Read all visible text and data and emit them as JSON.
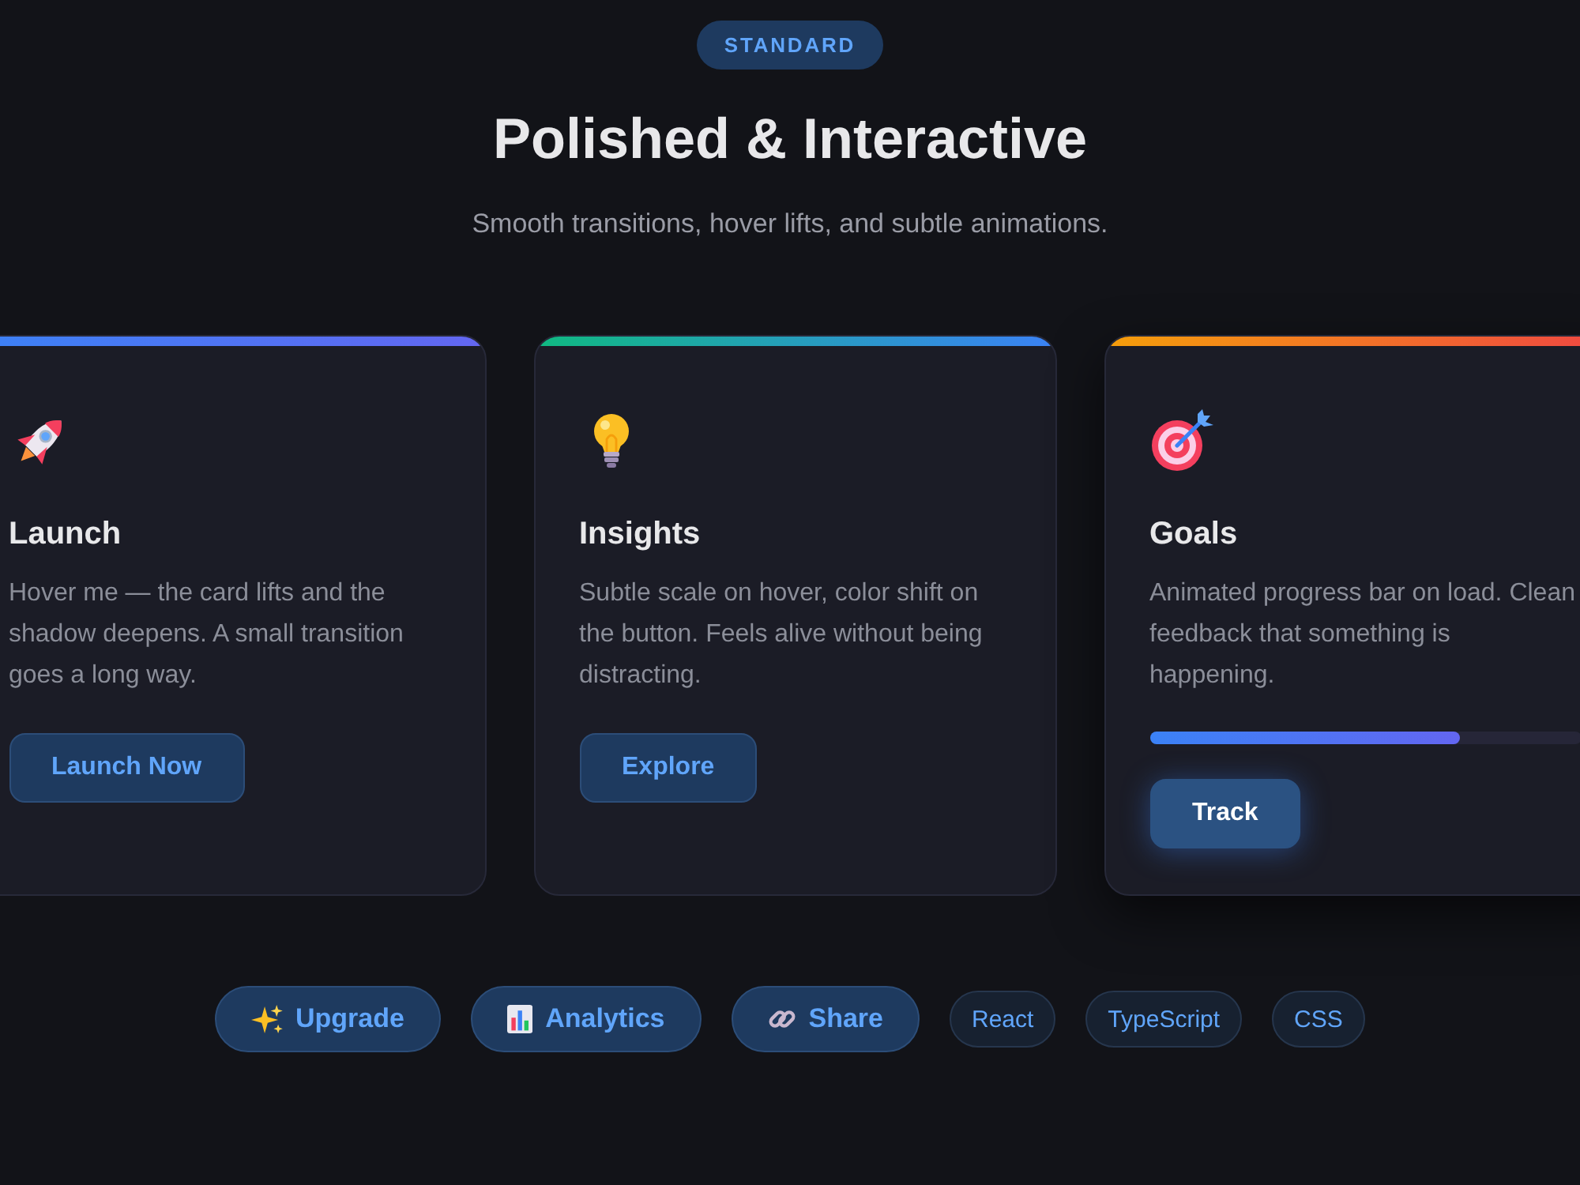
{
  "badge": "STANDARD",
  "title": "Polished & Interactive",
  "subtitle": "Smooth transitions, hover lifts, and subtle animations.",
  "cards": [
    {
      "title": "Launch",
      "description": "Hover me — the card lifts and the shadow deepens. A small transition goes a long way.",
      "button": "Launch Now",
      "hovered": false,
      "gradient": [
        {
          "color": "#3b82f6"
        },
        {
          "color": "#6366f1"
        }
      ]
    },
    {
      "title": "Insights",
      "description": "Subtle scale on hover, color shift on the button. Feels alive without being distracting.",
      "button": "Explore",
      "hovered": false,
      "gradient": [
        {
          "color": "#10b981"
        },
        {
          "color": "#3b82f6"
        }
      ]
    },
    {
      "title": "Goals",
      "description": "Animated progress bar on load. Clean feedback that something is happening.",
      "progress": {
        "level": 0.72
      },
      "button": "Track",
      "hovered": true,
      "gradient": [
        {
          "color": "#f59e0b"
        },
        {
          "color": "#ef4444"
        }
      ]
    }
  ],
  "actions": [
    {
      "kind": "button",
      "label": "Upgrade"
    },
    {
      "kind": "button",
      "label": "Analytics"
    },
    {
      "kind": "button",
      "label": "Share"
    },
    {
      "kind": "tag",
      "label": "React"
    },
    {
      "kind": "tag",
      "label": "TypeScript"
    },
    {
      "kind": "tag",
      "label": "CSS"
    }
  ]
}
